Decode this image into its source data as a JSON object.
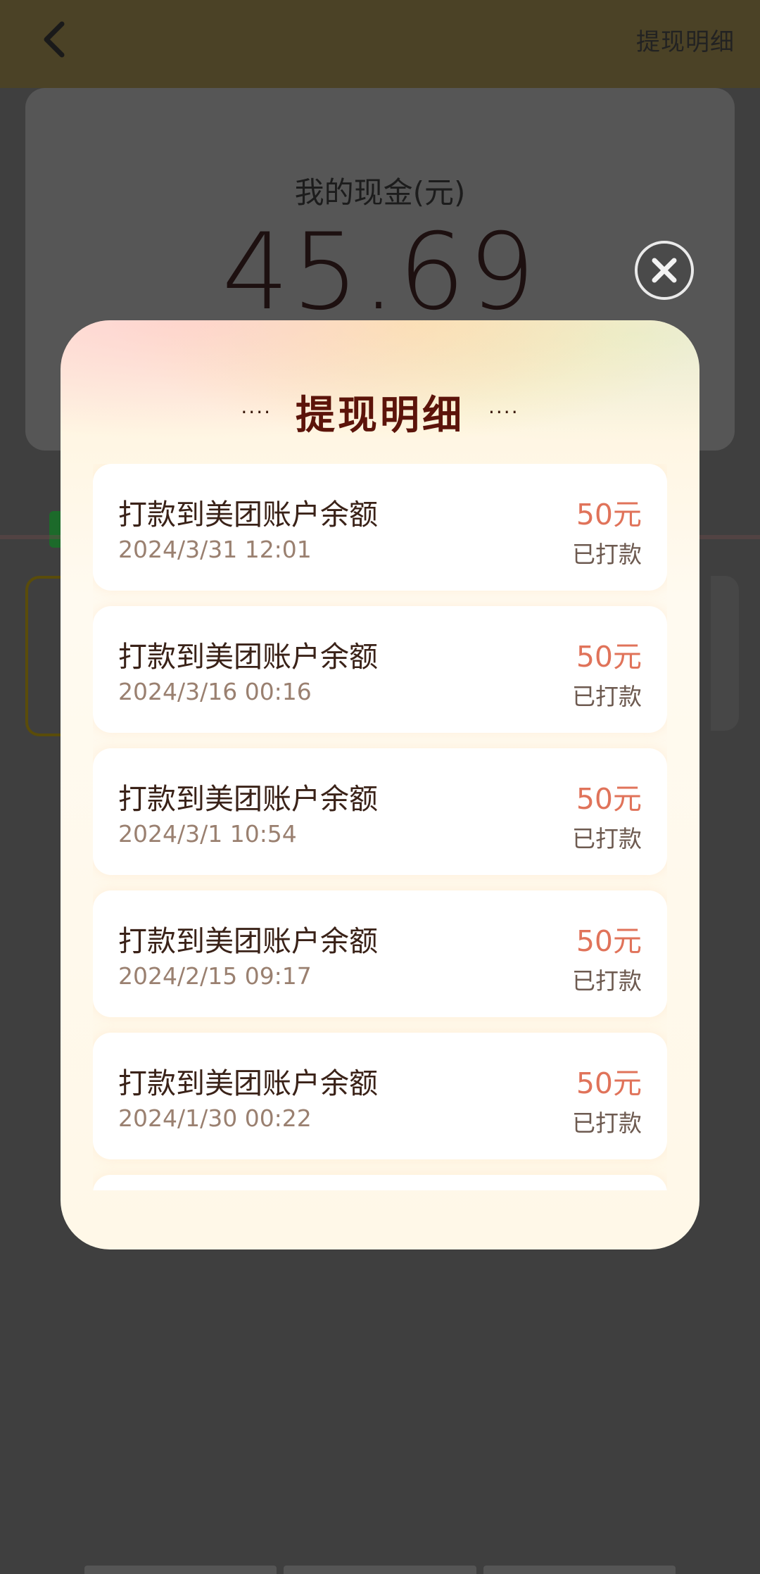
{
  "header": {
    "link_label": "提现明细"
  },
  "cash_card": {
    "label": "我的现金(元)",
    "amount": "45.69"
  },
  "modal": {
    "title": "提现明细",
    "dots_left": "····",
    "dots_right": "····",
    "records": [
      {
        "title": "打款到美团账户余额",
        "date": "2024/3/31 12:01",
        "amount": "50元",
        "status": "已打款"
      },
      {
        "title": "打款到美团账户余额",
        "date": "2024/3/16 00:16",
        "amount": "50元",
        "status": "已打款"
      },
      {
        "title": "打款到美团账户余额",
        "date": "2024/3/1 10:54",
        "amount": "50元",
        "status": "已打款"
      },
      {
        "title": "打款到美团账户余额",
        "date": "2024/2/15 09:17",
        "amount": "50元",
        "status": "已打款"
      },
      {
        "title": "打款到美团账户余额",
        "date": "2024/1/30 00:22",
        "amount": "50元",
        "status": "已打款"
      }
    ]
  },
  "colors": {
    "amount": "#e0735a",
    "title": "#5c140a",
    "overlay": "#3f3f3f"
  }
}
